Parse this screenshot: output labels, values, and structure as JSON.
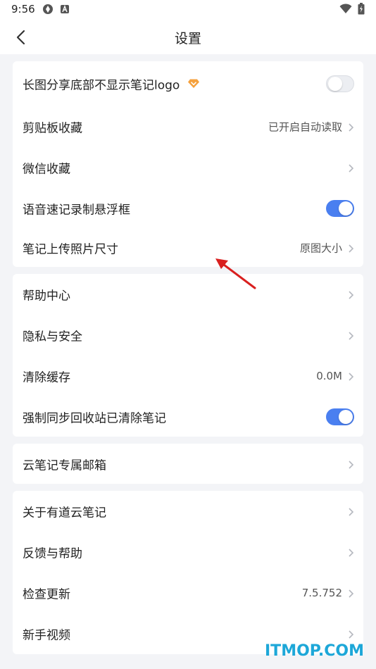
{
  "status_bar": {
    "time": "9:56",
    "icons": [
      "wifi-icon",
      "battery-icon",
      "app-notification-icon",
      "a-notification-icon"
    ]
  },
  "header": {
    "title": "设置",
    "back_icon": "back-chevron-icon"
  },
  "groups": [
    {
      "rows": [
        {
          "label": "长图分享底部不显示笔记logo",
          "control": "toggle",
          "on": false,
          "badge": "vip-diamond-icon"
        },
        {
          "label": "剪贴板收藏",
          "value": "已开启自动读取",
          "control": "chevron"
        },
        {
          "label": "微信收藏",
          "control": "chevron"
        },
        {
          "label": "语音速记录制悬浮框",
          "control": "toggle",
          "on": true
        },
        {
          "label": "笔记上传照片尺寸",
          "value": "原图大小",
          "control": "chevron"
        }
      ]
    },
    {
      "rows": [
        {
          "label": "帮助中心",
          "control": "chevron"
        },
        {
          "label": "隐私与安全",
          "control": "chevron"
        },
        {
          "label": "清除缓存",
          "value": "0.0M",
          "control": "chevron"
        },
        {
          "label": "强制同步回收站已清除笔记",
          "control": "toggle",
          "on": true
        }
      ]
    },
    {
      "rows": [
        {
          "label": "云笔记专属邮箱",
          "control": "chevron"
        }
      ]
    },
    {
      "rows": [
        {
          "label": "关于有道云笔记",
          "control": "chevron"
        },
        {
          "label": "反馈与帮助",
          "control": "chevron"
        },
        {
          "label": "检查更新",
          "value": "7.5.752",
          "control": "chevron"
        },
        {
          "label": "新手视频",
          "control": "chevron"
        }
      ]
    }
  ],
  "watermark": "ITMOP.COM",
  "colors": {
    "accent": "#4a7ff0",
    "background": "#f3f4f7",
    "annotation_arrow": "#d9201f",
    "watermark": "#1da7d8",
    "badge": "#f5a13d"
  }
}
